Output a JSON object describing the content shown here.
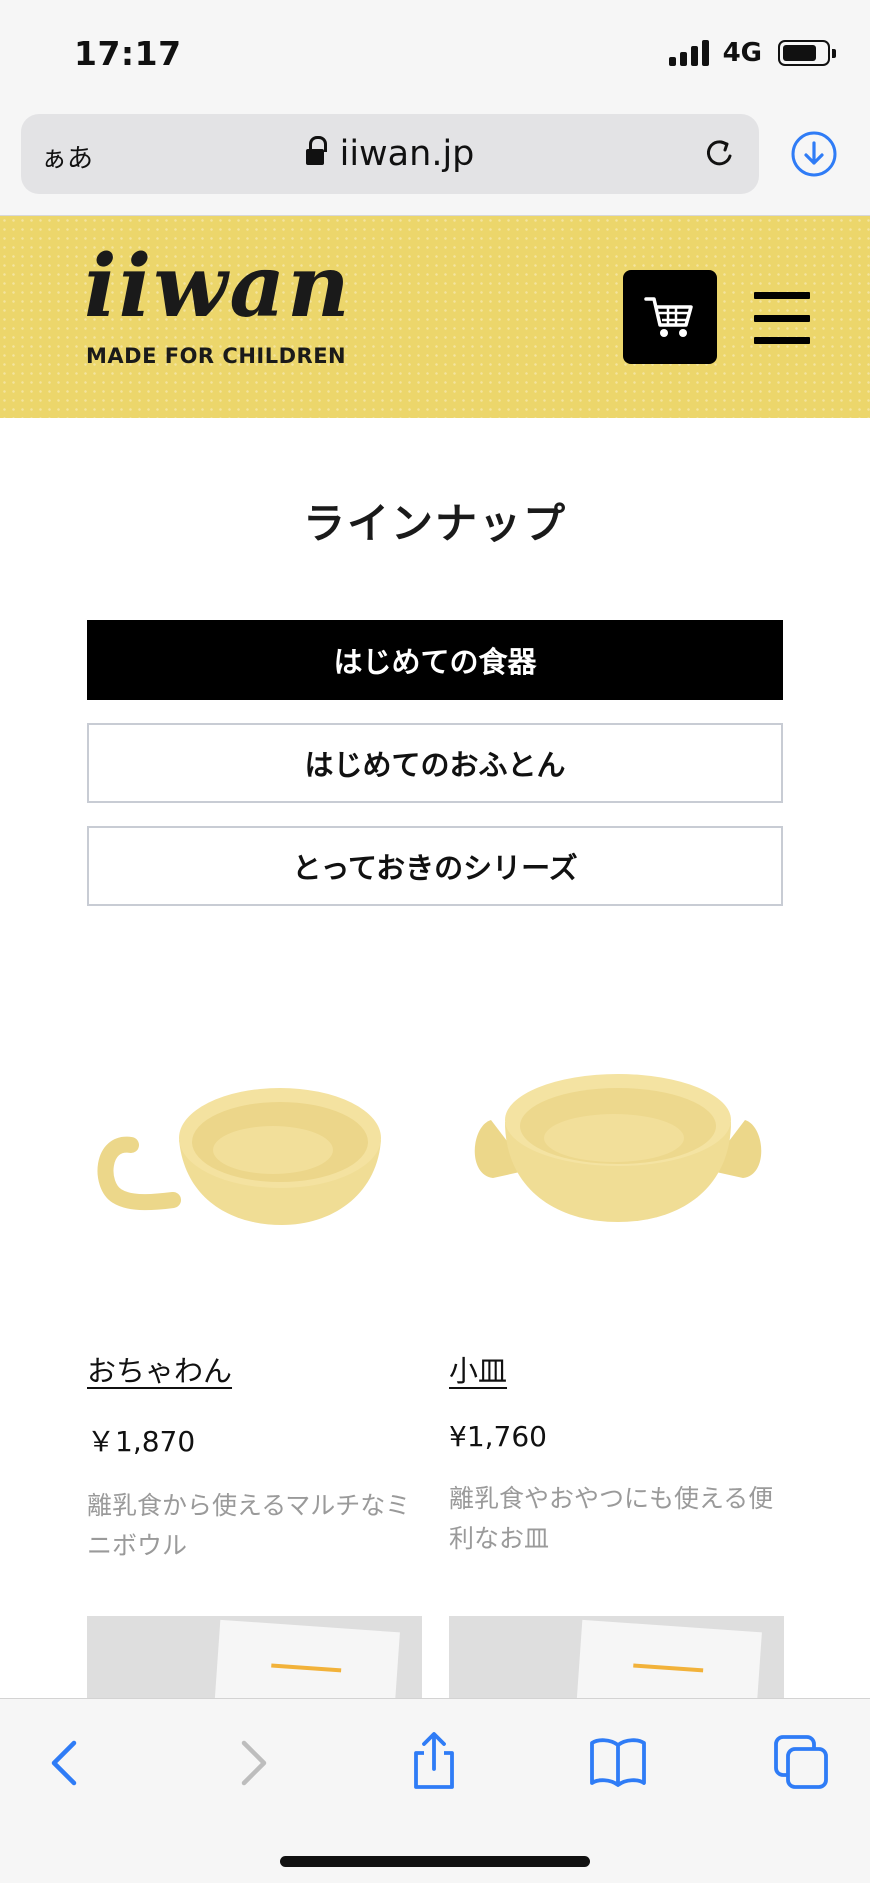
{
  "status": {
    "time": "17:17",
    "network": "4G"
  },
  "browser": {
    "text_size_label": "ぁあ",
    "url": "iiwan.jp"
  },
  "header": {
    "logo_word": "iiwan",
    "logo_tagline": "MADE FOR CHILDREN"
  },
  "page": {
    "title": "ラインナップ"
  },
  "tabs": [
    {
      "label": "はじめての食器",
      "active": true
    },
    {
      "label": "はじめてのおふとん",
      "active": false
    },
    {
      "label": "とっておきのシリーズ",
      "active": false
    }
  ],
  "products": [
    {
      "name": "おちゃわん",
      "price": "￥1,870",
      "desc": "離乳食から使えるマルチなミニボウル"
    },
    {
      "name": "小皿",
      "price": "¥1,760",
      "desc": "離乳食やおやつにも使える便利なお皿"
    }
  ],
  "colors": {
    "header_bg": "#ecd66b",
    "ios_blue": "#2f7cf6",
    "product_yellow": "#f2e1a0"
  },
  "icons": [
    "lock-icon",
    "reload-icon",
    "download-icon",
    "cart-icon",
    "hamburger-menu-icon",
    "back-icon",
    "forward-icon",
    "share-icon",
    "bookmarks-icon",
    "tabs-icon"
  ]
}
